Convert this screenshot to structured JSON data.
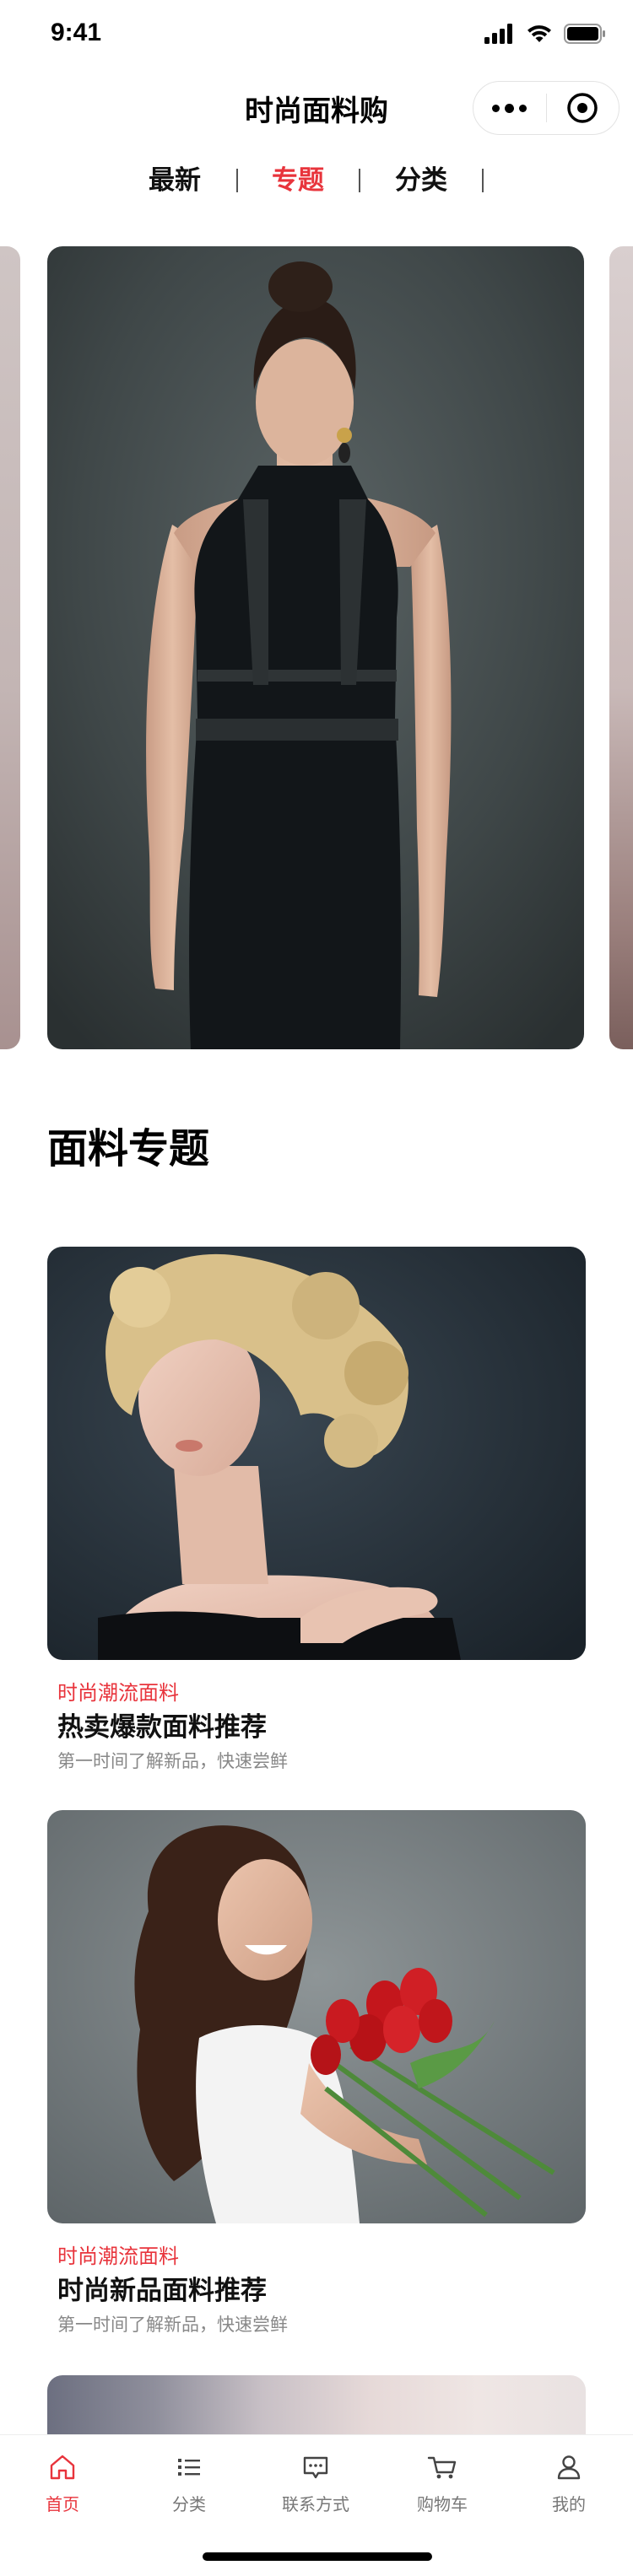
{
  "status_bar": {
    "time": "9:41"
  },
  "header": {
    "title": "时尚面料购"
  },
  "tabs": [
    {
      "label": "最新",
      "active": false
    },
    {
      "label": "专题",
      "active": true
    },
    {
      "label": "分类",
      "active": false
    }
  ],
  "section": {
    "title": "面料专题"
  },
  "cards": [
    {
      "tag": "时尚潮流面料",
      "title": "热卖爆款面料推荐",
      "desc": "第一时间了解新品，快速尝鲜"
    },
    {
      "tag": "时尚潮流面料",
      "title": "时尚新品面料推荐",
      "desc": "第一时间了解新品，快速尝鲜"
    }
  ],
  "tabbar": [
    {
      "label": "首页",
      "icon": "home-icon",
      "active": true
    },
    {
      "label": "分类",
      "icon": "list-icon",
      "active": false
    },
    {
      "label": "联系方式",
      "icon": "message-icon",
      "active": false
    },
    {
      "label": "购物车",
      "icon": "cart-icon",
      "active": false
    },
    {
      "label": "我的",
      "icon": "user-icon",
      "active": false
    }
  ],
  "colors": {
    "accent": "#e8343c",
    "text": "#111111",
    "muted": "#888888"
  }
}
